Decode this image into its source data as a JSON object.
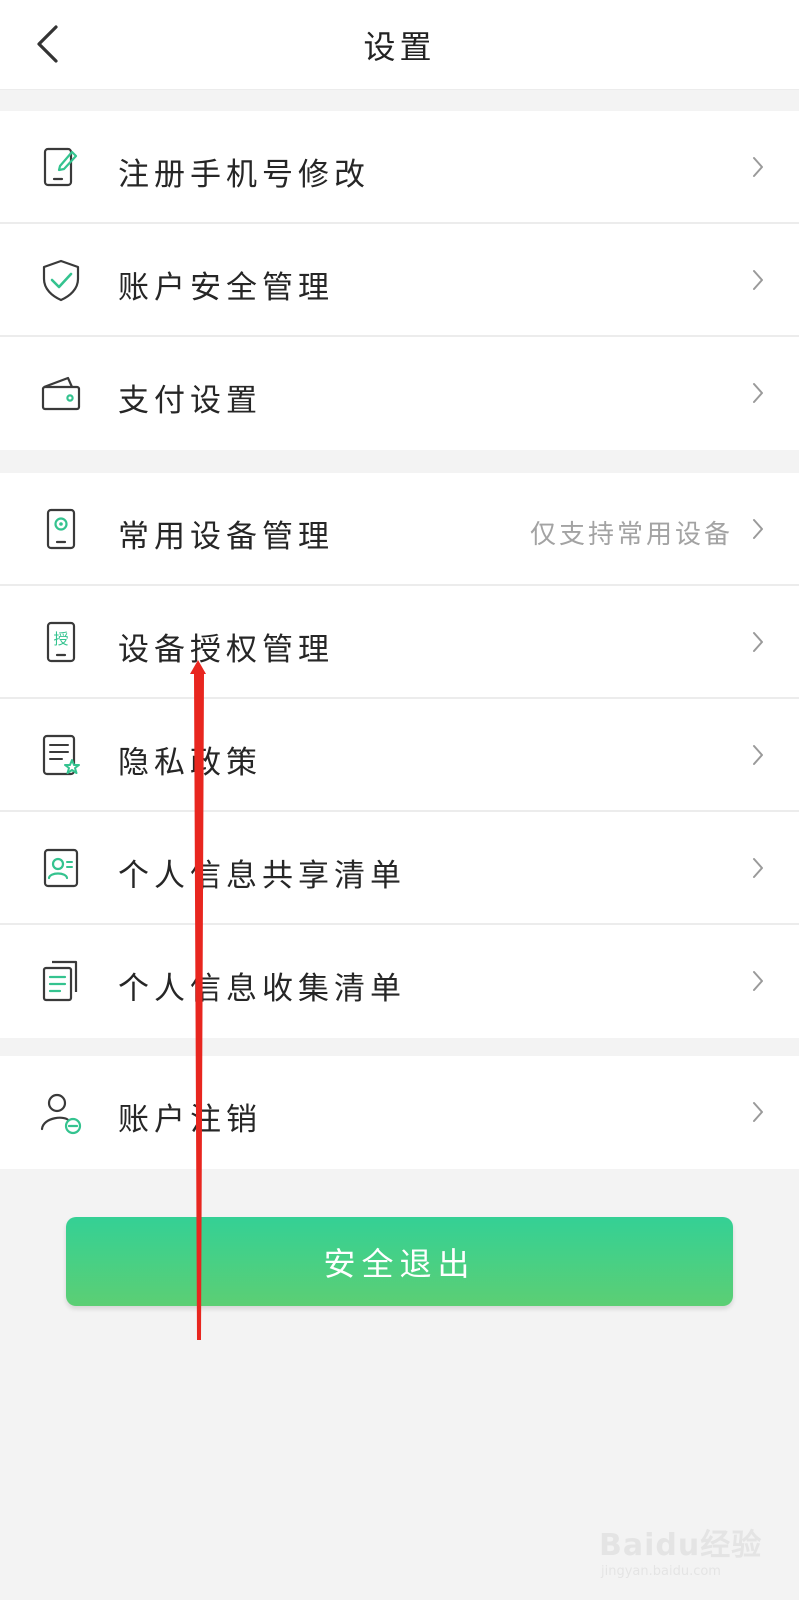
{
  "header": {
    "title": "设置",
    "back_icon": "chevron-left-icon"
  },
  "groups": [
    {
      "items": [
        {
          "label": "注册手机号修改",
          "icon": "phone-edit-icon",
          "hint": ""
        },
        {
          "label": "账户安全管理",
          "icon": "shield-check-icon",
          "hint": ""
        },
        {
          "label": "支付设置",
          "icon": "wallet-icon",
          "hint": ""
        }
      ]
    },
    {
      "items": [
        {
          "label": "常用设备管理",
          "icon": "device-gear-icon",
          "hint": "仅支持常用设备"
        },
        {
          "label": "设备授权管理",
          "icon": "device-authorize-icon",
          "hint": ""
        },
        {
          "label": "隐私政策",
          "icon": "document-star-icon",
          "hint": ""
        },
        {
          "label": "个人信息共享清单",
          "icon": "contact-card-icon",
          "hint": ""
        },
        {
          "label": "个人信息收集清单",
          "icon": "documents-list-icon",
          "hint": ""
        }
      ]
    },
    {
      "items": [
        {
          "label": "账户注销",
          "icon": "user-remove-icon",
          "hint": ""
        }
      ]
    }
  ],
  "device_authorize_icon_glyph": "授",
  "logout_button": "安全退出",
  "watermark": {
    "brand": "Baidu经验",
    "url": "jingyan.baidu.com"
  },
  "colors": {
    "accent": "#34d095",
    "accent_bottom": "#5ccf74",
    "annotation_arrow": "#e8261f"
  }
}
